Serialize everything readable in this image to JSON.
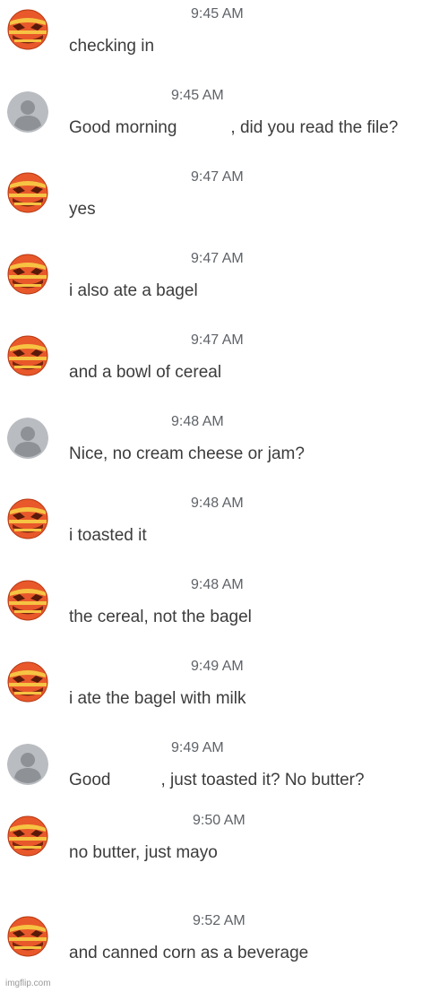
{
  "colors": {
    "avatar_gray_bg": "#b9bcc0",
    "avatar_gray_fg": "#8e9297",
    "emoji_orange": "#e8582a",
    "emoji_yellow": "#f6c343",
    "text": "#3c3c3c",
    "timestamp": "#5f6368"
  },
  "messages": [
    {
      "avatar": "emoji-face-icon",
      "time": "9:45 AM",
      "text": "checking in"
    },
    {
      "avatar": "default-user-icon",
      "time": "9:45 AM",
      "text_before": "Good morning",
      "text_after": ", did you read the file?"
    },
    {
      "avatar": "emoji-face-icon",
      "time": "9:47 AM",
      "text": "yes"
    },
    {
      "avatar": "emoji-face-icon",
      "time": "9:47 AM",
      "text": "i also ate a bagel"
    },
    {
      "avatar": "emoji-face-icon",
      "time": "9:47 AM",
      "text": "and a bowl of cereal"
    },
    {
      "avatar": "default-user-icon",
      "time": "9:48 AM",
      "text": "Nice, no cream cheese or jam?"
    },
    {
      "avatar": "emoji-face-icon",
      "time": "9:48 AM",
      "text": "i toasted it"
    },
    {
      "avatar": "emoji-face-icon",
      "time": "9:48 AM",
      "text": "the cereal, not the bagel"
    },
    {
      "avatar": "emoji-face-icon",
      "time": "9:49 AM",
      "text": "i ate the bagel with milk"
    },
    {
      "avatar": "default-user-icon",
      "time": "9:49 AM",
      "text_before": "Good",
      "text_after": ", just toasted it? No butter?"
    },
    {
      "avatar": "emoji-face-icon",
      "time": "9:50 AM",
      "text": "no butter, just mayo"
    },
    {
      "avatar": "emoji-face-icon",
      "time": "9:52 AM",
      "text": "and canned corn as a beverage"
    }
  ],
  "watermark": "imgflip.com"
}
